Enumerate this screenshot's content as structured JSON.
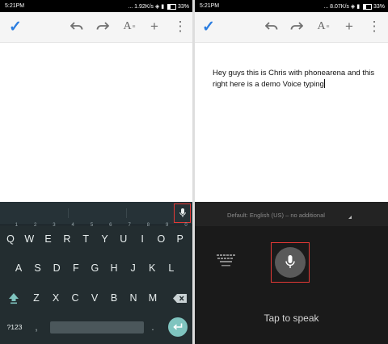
{
  "left": {
    "status": {
      "time": "5:21PM",
      "speed": "1.92K/s",
      "battery": "33%"
    },
    "keyboard": {
      "row1": [
        {
          "k": "Q",
          "h": "1"
        },
        {
          "k": "W",
          "h": "2"
        },
        {
          "k": "E",
          "h": "3"
        },
        {
          "k": "R",
          "h": "4"
        },
        {
          "k": "T",
          "h": "5"
        },
        {
          "k": "Y",
          "h": "6"
        },
        {
          "k": "U",
          "h": "7"
        },
        {
          "k": "I",
          "h": "8"
        },
        {
          "k": "O",
          "h": "9"
        },
        {
          "k": "P",
          "h": "0"
        }
      ],
      "row2": [
        "A",
        "S",
        "D",
        "F",
        "G",
        "H",
        "J",
        "K",
        "L"
      ],
      "row3": [
        "Z",
        "X",
        "C",
        "V",
        "B",
        "N",
        "M"
      ],
      "symbols_label": "?123",
      "comma_label": ",",
      "period_label": "."
    }
  },
  "right": {
    "status": {
      "time": "5:21PM",
      "speed": "8.07K/s",
      "battery": "33%"
    },
    "doc_text": "Hey guys this is Chris with phonearena and this right here is a demo Voice typing",
    "voice": {
      "language": "Default: English (US) – no additional",
      "tap_label": "Tap to speak"
    }
  },
  "colors": {
    "accent": "#2b7de0",
    "highlight": "#e53935",
    "enter_key": "#7fc4bf"
  }
}
